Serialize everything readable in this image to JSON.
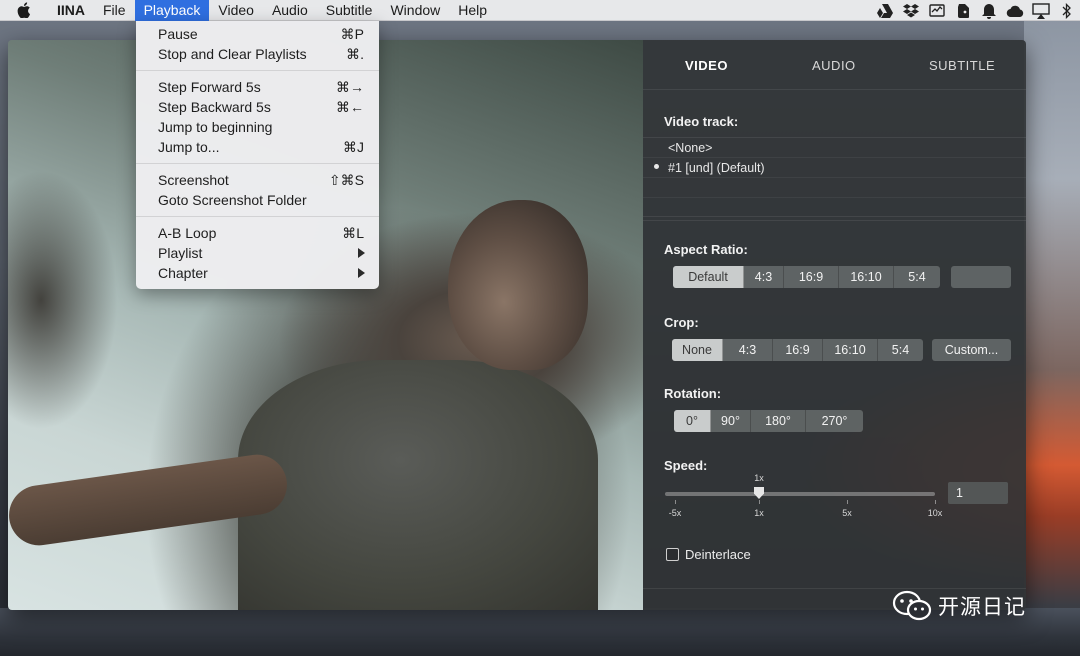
{
  "menubar": {
    "app_name": "IINA",
    "items": [
      "File",
      "Playback",
      "Video",
      "Audio",
      "Subtitle",
      "Window",
      "Help"
    ],
    "active_item": "Playback",
    "status_icons": [
      "google-drive-icon",
      "dropbox-icon",
      "activity-monitor-icon",
      "evernote-icon",
      "bell-icon",
      "cloud-icon",
      "airplay-icon",
      "bluetooth-icon"
    ]
  },
  "playback_menu": {
    "groups": [
      [
        {
          "label": "Pause",
          "shortcut": "⌘P"
        },
        {
          "label": "Stop and Clear Playlists",
          "shortcut": "⌘."
        }
      ],
      [
        {
          "label": "Step Forward 5s",
          "shortcut": "⌘→"
        },
        {
          "label": "Step Backward 5s",
          "shortcut": "⌘←"
        },
        {
          "label": "Jump to beginning",
          "shortcut": ""
        },
        {
          "label": "Jump to...",
          "shortcut": "⌘J"
        }
      ],
      [
        {
          "label": "Screenshot",
          "shortcut": "⇧⌘S"
        },
        {
          "label": "Goto Screenshot Folder",
          "shortcut": ""
        }
      ],
      [
        {
          "label": "A-B Loop",
          "shortcut": "⌘L"
        },
        {
          "label": "Playlist",
          "submenu": true
        },
        {
          "label": "Chapter",
          "submenu": true
        }
      ]
    ]
  },
  "panel": {
    "tabs": [
      "VIDEO",
      "AUDIO",
      "SUBTITLE"
    ],
    "active_tab": "VIDEO",
    "video_track": {
      "label": "Video track:",
      "tracks": [
        {
          "name": "<None>",
          "selected": false
        },
        {
          "name": "#1 [und] (Default)",
          "selected": true
        }
      ]
    },
    "aspect_ratio": {
      "label": "Aspect Ratio:",
      "options": [
        "Default",
        "4:3",
        "16:9",
        "16:10",
        "5:4"
      ],
      "selected": "Default"
    },
    "crop": {
      "label": "Crop:",
      "options": [
        "None",
        "4:3",
        "16:9",
        "16:10",
        "5:4"
      ],
      "selected": "None",
      "custom_label": "Custom..."
    },
    "rotation": {
      "label": "Rotation:",
      "options": [
        "0°",
        "90°",
        "180°",
        "270°"
      ],
      "selected": "0°"
    },
    "speed": {
      "label": "Speed:",
      "ticks": [
        "-5x",
        "1x",
        "5x",
        "10x"
      ],
      "current_label": "1x",
      "value": "1"
    },
    "deinterlace": {
      "label": "Deinterlace",
      "checked": false
    }
  },
  "watermark": {
    "text": "开源日记"
  }
}
